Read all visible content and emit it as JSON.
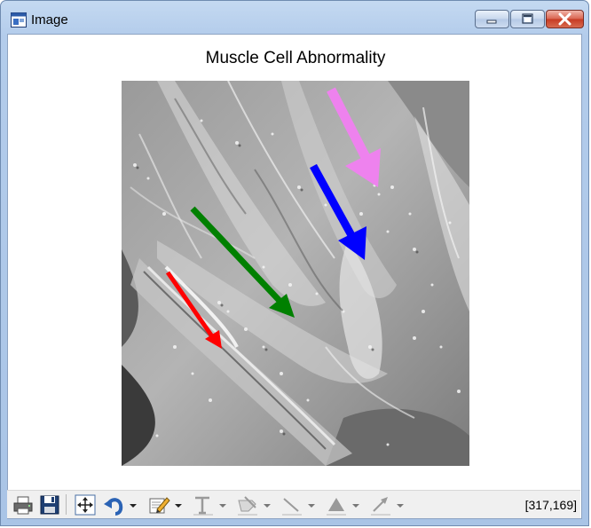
{
  "window": {
    "title": "Image",
    "icon": "figure-window-icon",
    "controls": [
      "minimize-icon",
      "maximize-icon",
      "close-icon"
    ]
  },
  "figure": {
    "title": "Muscle Cell Abnormality",
    "image": "grayscale microscopy image of muscle cells with colored arrows",
    "arrows": [
      {
        "color": "#ff00ff",
        "name": "pink-arrow"
      },
      {
        "color": "#0000ff",
        "name": "blue-arrow"
      },
      {
        "color": "#008000",
        "name": "green-arrow"
      },
      {
        "color": "#ff0000",
        "name": "red-arrow"
      }
    ]
  },
  "toolbar": {
    "tools": [
      "print-icon",
      "save-icon",
      "fit-view-icon",
      "undo-icon",
      "edit-icon",
      "text-icon",
      "brush-icon",
      "line-icon",
      "fill-icon",
      "arrow-icon"
    ],
    "cursor_readout": "[317,169]"
  }
}
